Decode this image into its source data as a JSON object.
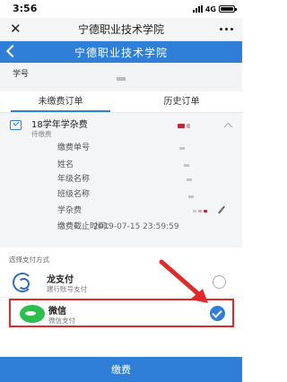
{
  "status_bar": {
    "time": "3:56",
    "network": "4G"
  },
  "window": {
    "title": "宁德职业技术学院"
  },
  "nav": {
    "title": "宁德职业技术学院"
  },
  "student": {
    "label": "学号"
  },
  "tabs": [
    {
      "label": "未缴费订单",
      "active": true
    },
    {
      "label": "历史订单",
      "active": false
    }
  ],
  "order": {
    "title": "18学年学杂费",
    "status": "待缴费",
    "fields": {
      "bill_no": "缴费单号",
      "name": "姓名",
      "grade": "年级名称",
      "class": "班级名称",
      "fee": "学杂费",
      "deadline_label": "缴费截止时间：",
      "deadline_value": "2019-07-15 23:59:59"
    },
    "marker_color": "#c0263a"
  },
  "payment": {
    "section_label": "选择支付方式",
    "options": [
      {
        "name": "龙支付",
        "sub": "建行账号支付",
        "icon": "longpay-icon",
        "selected": false
      },
      {
        "name": "微信",
        "sub": "微信支付",
        "icon": "wechat-icon",
        "selected": true
      }
    ]
  },
  "pay_button": {
    "label": "缴费"
  },
  "colors": {
    "primary": "#2f7fd8",
    "highlight": "#e02a2a",
    "wechat": "#2cbf4e"
  }
}
